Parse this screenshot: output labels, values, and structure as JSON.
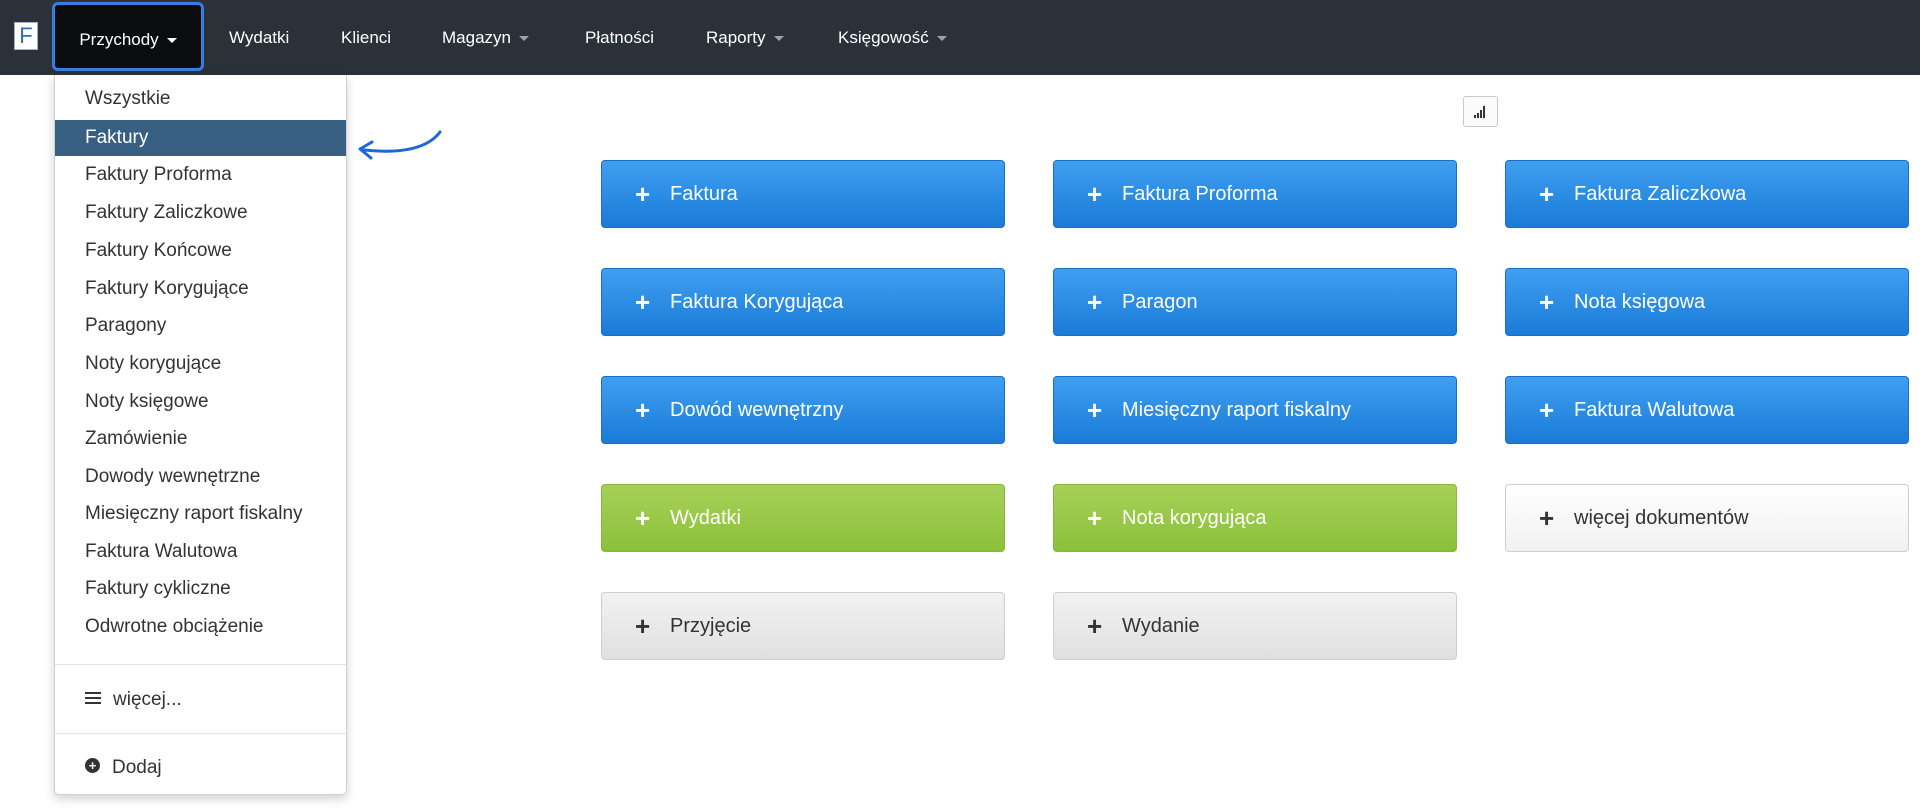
{
  "logo": {
    "letter": "F"
  },
  "navbar": {
    "items": [
      {
        "label": "Przychody",
        "has_caret": true,
        "active": true
      },
      {
        "label": "Wydatki",
        "has_caret": false
      },
      {
        "label": "Klienci",
        "has_caret": false
      },
      {
        "label": "Magazyn",
        "has_caret": true
      },
      {
        "label": "Płatności",
        "has_caret": false
      },
      {
        "label": "Raporty",
        "has_caret": true
      },
      {
        "label": "Księgowość",
        "has_caret": true
      }
    ]
  },
  "dropdown": {
    "items": [
      "Wszystkie",
      "Faktury",
      "Faktury Proforma",
      "Faktury Zaliczkowe",
      "Faktury Końcowe",
      "Faktury Korygujące",
      "Paragony",
      "Noty korygujące",
      "Noty księgowe",
      "Zamówienie",
      "Dowody wewnętrzne",
      "Miesięczny raport fiskalny",
      "Faktura Walutowa",
      "Faktury cykliczne",
      "Odwrotne obciążenie"
    ],
    "selected": "Faktury",
    "more_label": "więcej...",
    "add_label": "Dodaj"
  },
  "tiles": [
    {
      "label": "Faktura",
      "color": "blue"
    },
    {
      "label": "Faktura Proforma",
      "color": "blue"
    },
    {
      "label": "Faktura Zaliczkowa",
      "color": "blue"
    },
    {
      "label": "Faktura Korygująca",
      "color": "blue"
    },
    {
      "label": "Paragon",
      "color": "blue"
    },
    {
      "label": "Nota księgowa",
      "color": "blue"
    },
    {
      "label": "Dowód wewnętrzny",
      "color": "blue"
    },
    {
      "label": "Miesięczny raport fiskalny",
      "color": "blue"
    },
    {
      "label": "Faktura Walutowa",
      "color": "blue"
    },
    {
      "label": "Wydatki",
      "color": "green"
    },
    {
      "label": "Nota korygująca",
      "color": "green"
    },
    {
      "label": "więcej dokumentów",
      "color": "white"
    },
    {
      "label": "Przyjęcie",
      "color": "grey"
    },
    {
      "label": "Wydanie",
      "color": "grey"
    }
  ],
  "icons": {
    "chart_button": "signal-bars-icon",
    "plus": "plus-icon",
    "more": "hamburger-icon",
    "add": "plus-circle-icon",
    "annotation": "curved-arrow-icon"
  },
  "colors": {
    "navbar_bg": "#2b3138",
    "active_highlight": "#3a7de0",
    "selected_item": "#365f82",
    "blue_button": "#1a7bd8",
    "green_button": "#8cc03a"
  }
}
